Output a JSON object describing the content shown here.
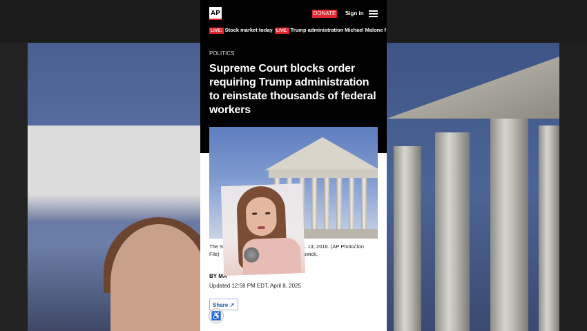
{
  "ticker": [
    {
      "live": "LIVE:",
      "text": "Stock market today"
    },
    {
      "live": "LIVE:",
      "text": "Trump administration"
    },
    {
      "live": "",
      "text": "Michael Malone f"
    }
  ],
  "header": {
    "logo": "AP",
    "donate": "DONATE",
    "sign_in": "Sign in"
  },
  "article": {
    "section": "POLITICS",
    "headline": "Supreme Court blocks order requiring Trump administration to reinstate thousands of federal workers",
    "caption_left": "The Su",
    "caption_right": "eb. 13, 2016. (AP Photo/Jon Elswick,",
    "caption_line2": "File)",
    "byline_prefix": "BY",
    "byline_name": "MA",
    "updated": "Updated 12:58 PM EDT, April 8, 2025",
    "share": "Share"
  },
  "colors": {
    "accent_red": "#e0262f",
    "link_blue": "#1a5dad"
  },
  "icons": [
    "menu-icon",
    "share-icon",
    "accessibility-icon"
  ]
}
